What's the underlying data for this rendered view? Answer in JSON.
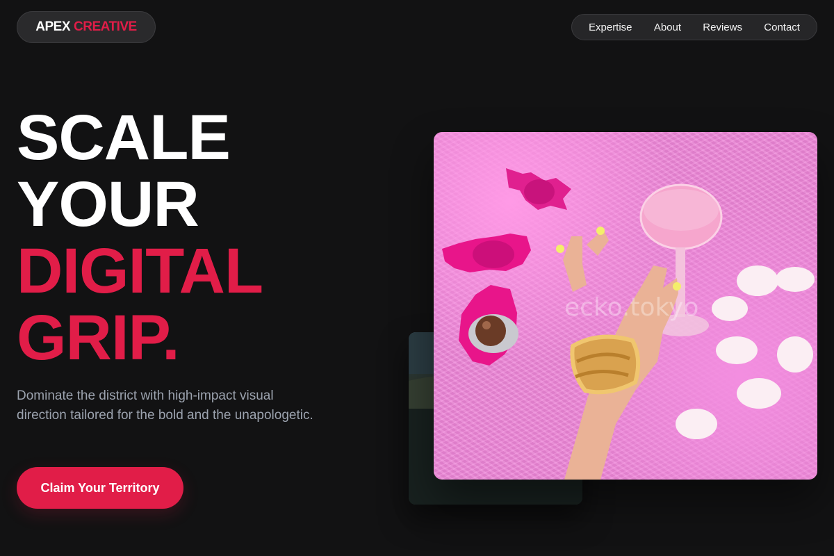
{
  "header": {
    "logo_primary": "APEX",
    "logo_accent": "CREATIVE",
    "nav": [
      "Expertise",
      "About",
      "Reviews",
      "Contact"
    ]
  },
  "hero": {
    "headline_line1": "SCALE",
    "headline_line2": "YOUR",
    "headline_line3": "DIGITAL",
    "headline_line4": "GRIP.",
    "subtext": "Dominate the district with high-impact visual direction tailored for the bold and the unapologetic.",
    "cta_label": "Claim Your Territory"
  },
  "images": {
    "main_photo_watermark": "ecko.tokyo",
    "main_photo_subject": "pink-fur-hand-cocktail-candies",
    "back_photo_subject": "landscape-photo"
  },
  "colors": {
    "background": "#121213",
    "accent": "#e11d48",
    "muted_text": "#9ca3af",
    "pill_bg": "#262628"
  }
}
